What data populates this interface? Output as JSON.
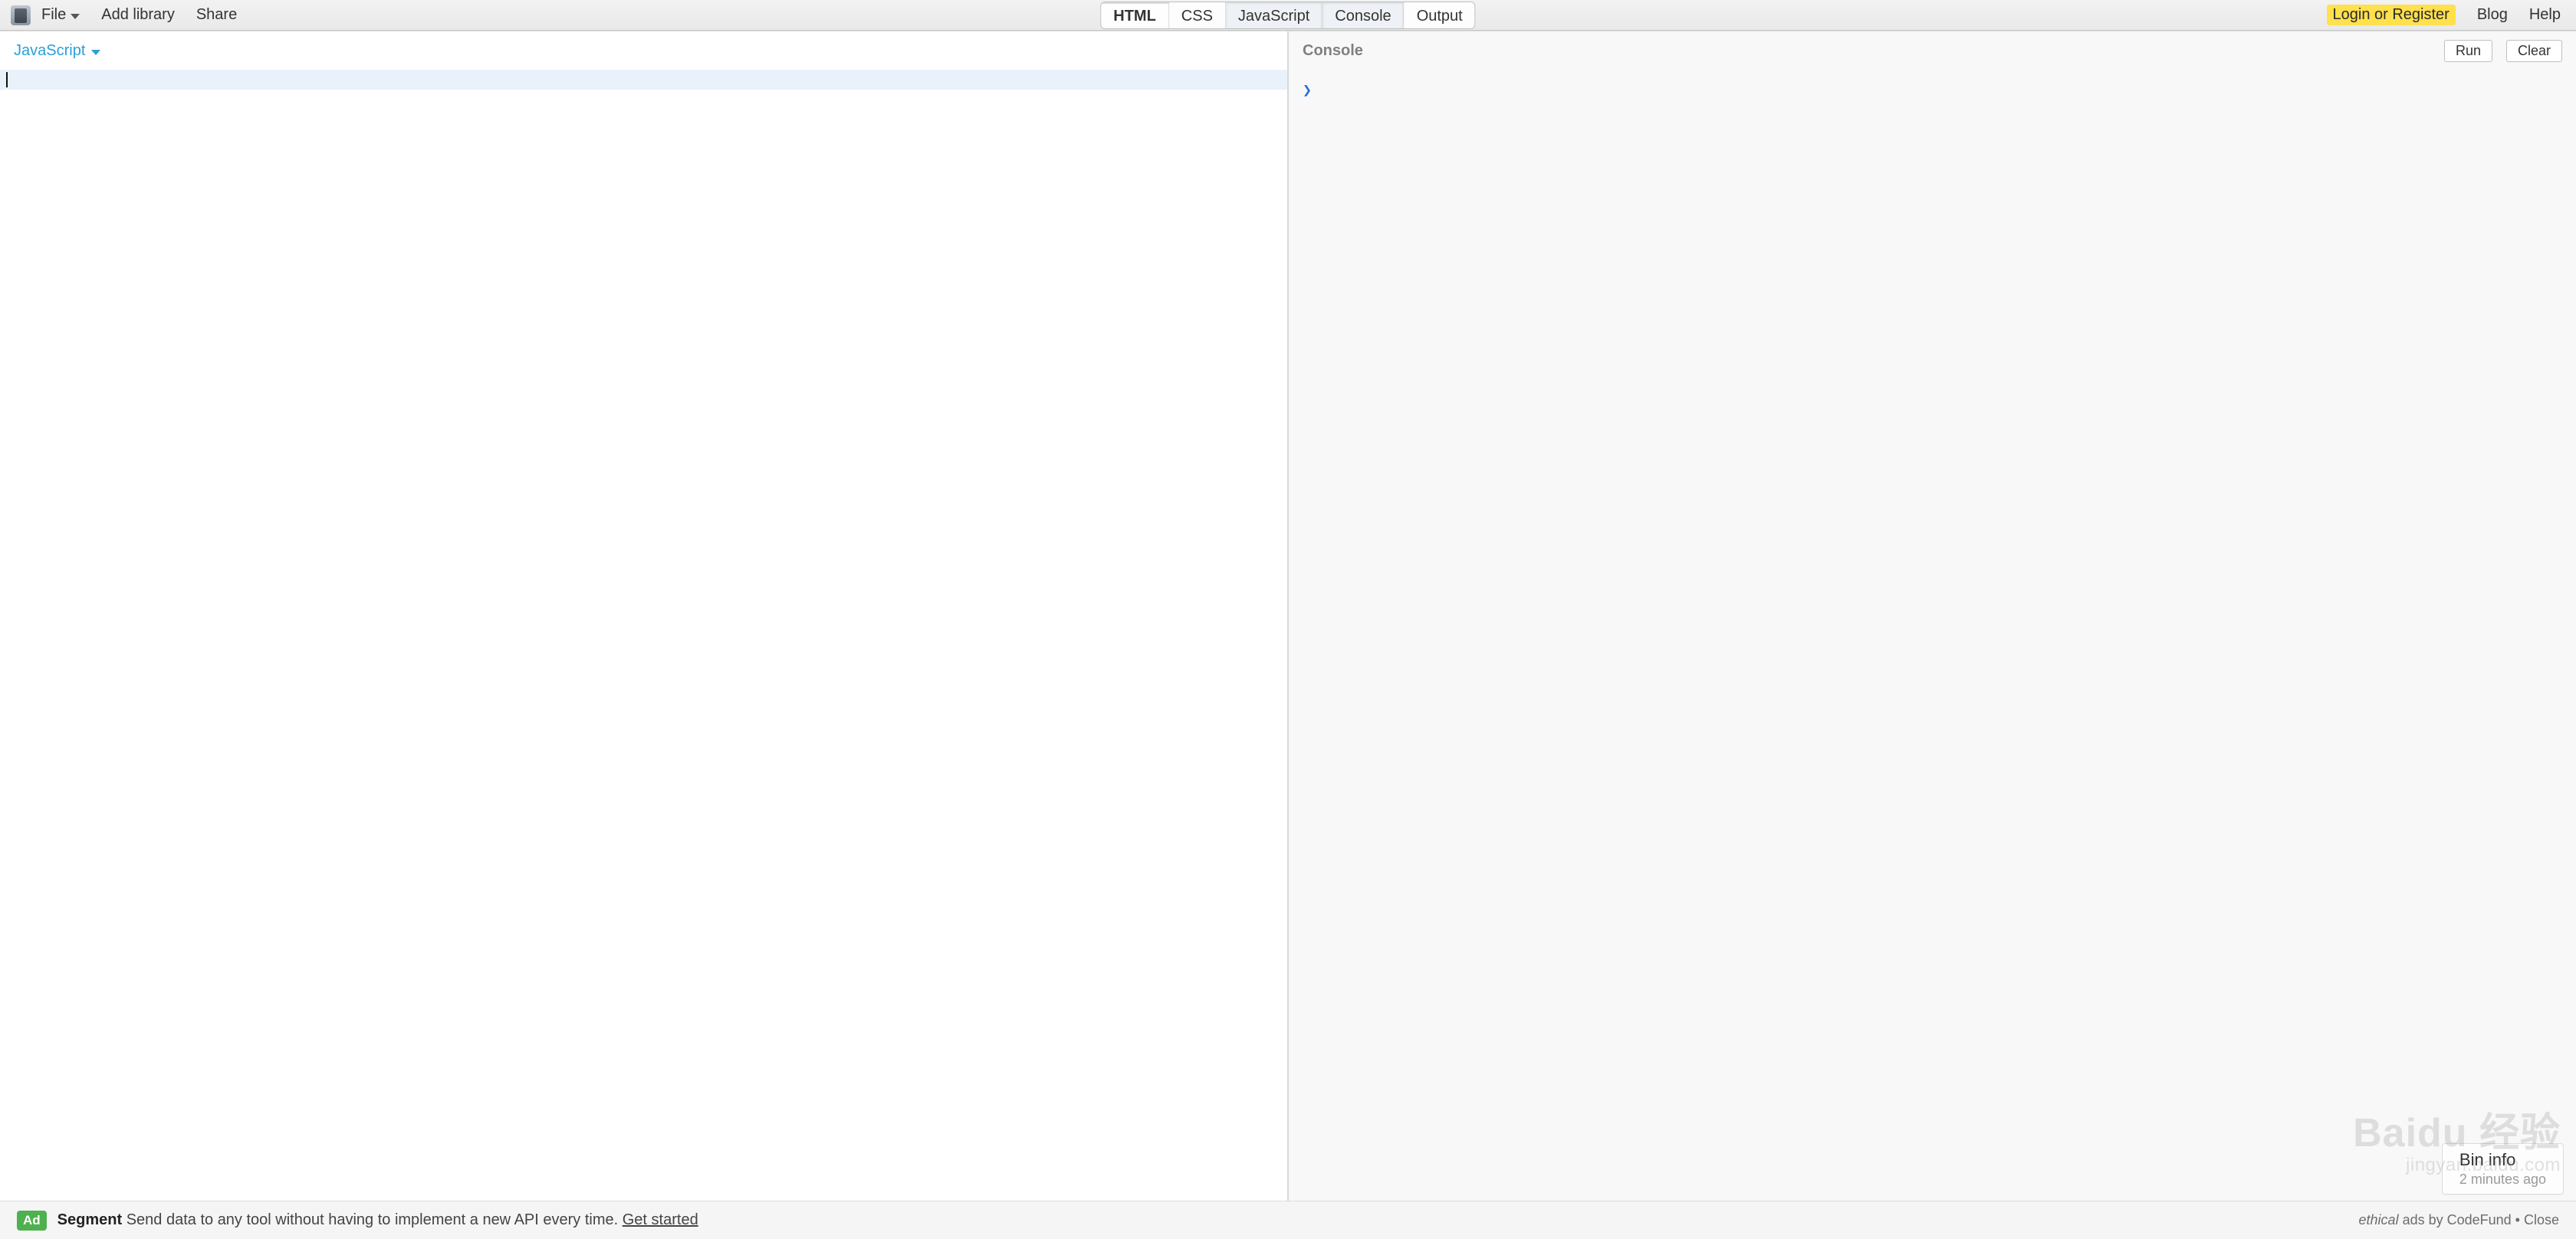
{
  "topbar": {
    "menu": {
      "file": "File",
      "add_library": "Add library",
      "share": "Share"
    },
    "tabs": [
      {
        "id": "html",
        "label": "HTML",
        "active": true
      },
      {
        "id": "css",
        "label": "CSS",
        "active": false
      },
      {
        "id": "javascript",
        "label": "JavaScript",
        "active": false,
        "pressed": true
      },
      {
        "id": "console",
        "label": "Console",
        "active": false,
        "pressed": true
      },
      {
        "id": "output",
        "label": "Output",
        "active": false
      }
    ],
    "right": {
      "login": "Login or Register",
      "blog": "Blog",
      "help": "Help"
    }
  },
  "editor": {
    "language_label": "JavaScript",
    "content": ""
  },
  "console": {
    "title": "Console",
    "run": "Run",
    "clear": "Clear",
    "prompt_glyph": "❯"
  },
  "bin_info": {
    "title": "Bin info",
    "subtitle": "2 minutes ago"
  },
  "footer": {
    "chip": "Ad",
    "brand": "Segment",
    "text": "Send data to any tool without having to implement a new API every time.",
    "cta": "Get started",
    "attrib_em": "ethical",
    "attrib_rest": " ads by CodeFund",
    "sep": " • ",
    "close": "Close"
  },
  "watermark": {
    "line1": "Baidu 经验",
    "line2": "jingyan.baidu.com"
  }
}
